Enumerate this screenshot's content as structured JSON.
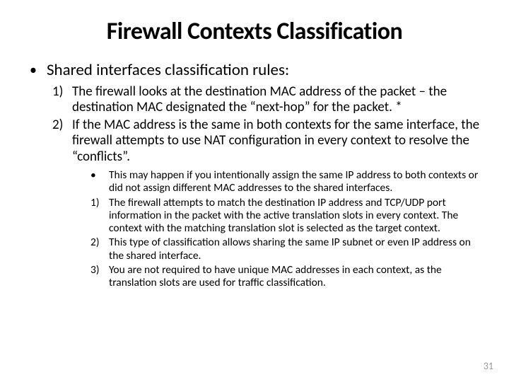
{
  "title": "Firewall Contexts Classification",
  "main_bullet": "Shared interfaces classification rules:",
  "numbered": [
    {
      "num": "1)",
      "text": "The firewall looks at the destination MAC address of the packet – the destination MAC designated the “next-hop” for the packet. *"
    },
    {
      "num": "2)",
      "text": "If the MAC address is the same in both contexts for the same interface, the firewall attempts to use NAT configuration in every context to resolve the “conflicts”."
    }
  ],
  "sub": [
    {
      "mark": "•",
      "text": "This may happen if you intentionally assign the same IP address to both contexts or did not assign different MAC addresses to the shared interfaces."
    },
    {
      "mark": "1)",
      "text": "The firewall attempts to match the destination IP address and TCP/UDP port information in the packet with the active translation slots in every context. The context with the matching translation slot is selected as the target context."
    },
    {
      "mark": "2)",
      "text": "This type of classification allows sharing the same IP subnet or even IP address on the shared interface."
    },
    {
      "mark": "3)",
      "text": "You are not required to have unique MAC addresses in each context, as the translation slots are used for traffic classification."
    }
  ],
  "page_number": "31"
}
